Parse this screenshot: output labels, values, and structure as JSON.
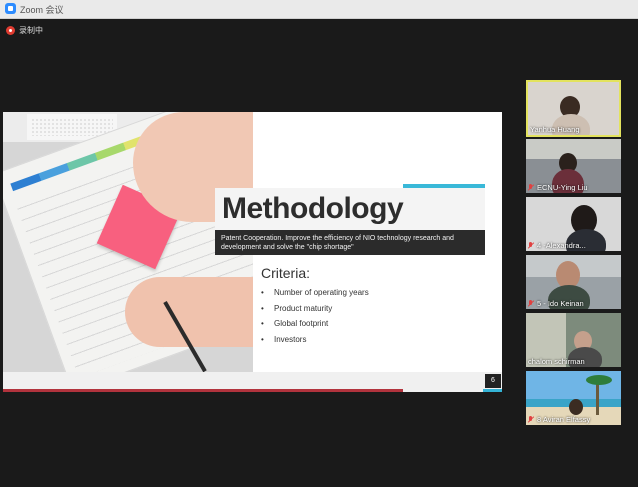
{
  "window": {
    "title": "Zoom 会议"
  },
  "recording": {
    "label": "录制中"
  },
  "slide": {
    "title": "Methodology",
    "subtitle": "Patent Cooperation. Improve the efficiency of NIO technology research and development and solve the \"chip shortage\"",
    "criteria_heading": "Criteria:",
    "bullets": [
      "Number of operating years",
      "Product maturity",
      "Global footprint",
      "Investors"
    ],
    "page_number": "6"
  },
  "participants": [
    {
      "name": "Yanhua Huang",
      "active": true,
      "muted": false
    },
    {
      "name": "ECNU-Ying Liu",
      "active": false,
      "muted": true
    },
    {
      "name": "4 -Alexandra...",
      "active": false,
      "muted": true
    },
    {
      "name": "5 - Ido Keinan",
      "active": false,
      "muted": true
    },
    {
      "name": "chalom schirman",
      "active": false,
      "muted": false
    },
    {
      "name": "8 Aviran Elfassy",
      "active": false,
      "muted": true
    }
  ],
  "colors": {
    "accent_blue": "#39b8d8",
    "accent_red": "#b2333d",
    "active_speaker": "#e3e35e",
    "sticky_note": "#f8607f"
  }
}
